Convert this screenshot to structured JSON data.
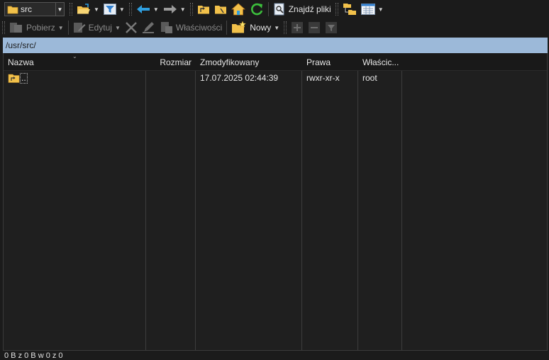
{
  "toolbar1": {
    "drive_combo_value": "src",
    "find_files_label": "Znajdź pliki"
  },
  "toolbar2": {
    "download_label": "Pobierz",
    "edit_label": "Edytuj",
    "properties_label": "Właściwości",
    "new_label": "Nowy"
  },
  "path": "/usr/src/",
  "columns": {
    "name": "Nazwa",
    "size": "Rozmiar",
    "modified": "Zmodyfikowany",
    "rights": "Prawa",
    "owner": "Właścic..."
  },
  "rows": [
    {
      "name": "..",
      "size": "",
      "modified": "17.07.2025 02:44:39",
      "rights": "rwxr-xr-x",
      "owner": "root"
    }
  ],
  "status_text": "0 B z 0 B w 0 z 0",
  "colors": {
    "path_bar": "#9cb9d9",
    "folder": "#f2c14a",
    "accent_blue": "#2f9fe0",
    "refresh_green": "#3cbf3c"
  }
}
